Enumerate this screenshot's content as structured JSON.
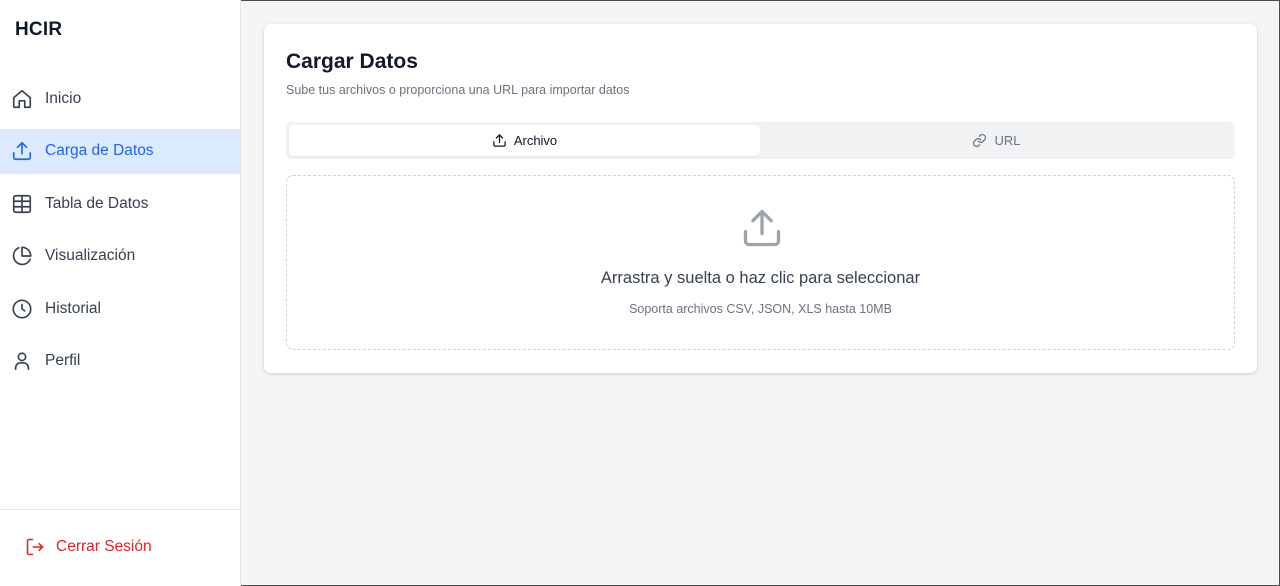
{
  "app": {
    "brand": "HCIR"
  },
  "sidebar": {
    "items": [
      {
        "label": "Inicio",
        "icon": "home-icon",
        "active": false
      },
      {
        "label": "Carga de Datos",
        "icon": "upload-icon",
        "active": true
      },
      {
        "label": "Tabla de Datos",
        "icon": "table-icon",
        "active": false
      },
      {
        "label": "Visualización",
        "icon": "pie-chart-icon",
        "active": false
      },
      {
        "label": "Historial",
        "icon": "clock-icon",
        "active": false
      },
      {
        "label": "Perfil",
        "icon": "user-icon",
        "active": false
      }
    ],
    "logout": {
      "label": "Cerrar Sesión",
      "icon": "logout-icon"
    }
  },
  "main": {
    "title": "Cargar Datos",
    "subtitle": "Sube tus archivos o proporciona una URL para importar datos",
    "tabs": [
      {
        "label": "Archivo",
        "icon": "upload-icon",
        "active": true
      },
      {
        "label": "URL",
        "icon": "link-icon",
        "active": false
      }
    ],
    "dropzone": {
      "icon": "upload-icon",
      "text": "Arrastra y suelta o haz clic para seleccionar",
      "hint": "Soporta archivos CSV, JSON, XLS hasta 10MB"
    }
  },
  "colors": {
    "accent": "#2563eb",
    "active_bg": "#dbeafe",
    "danger": "#dc2626",
    "page_bg": "#f5f5f6"
  }
}
